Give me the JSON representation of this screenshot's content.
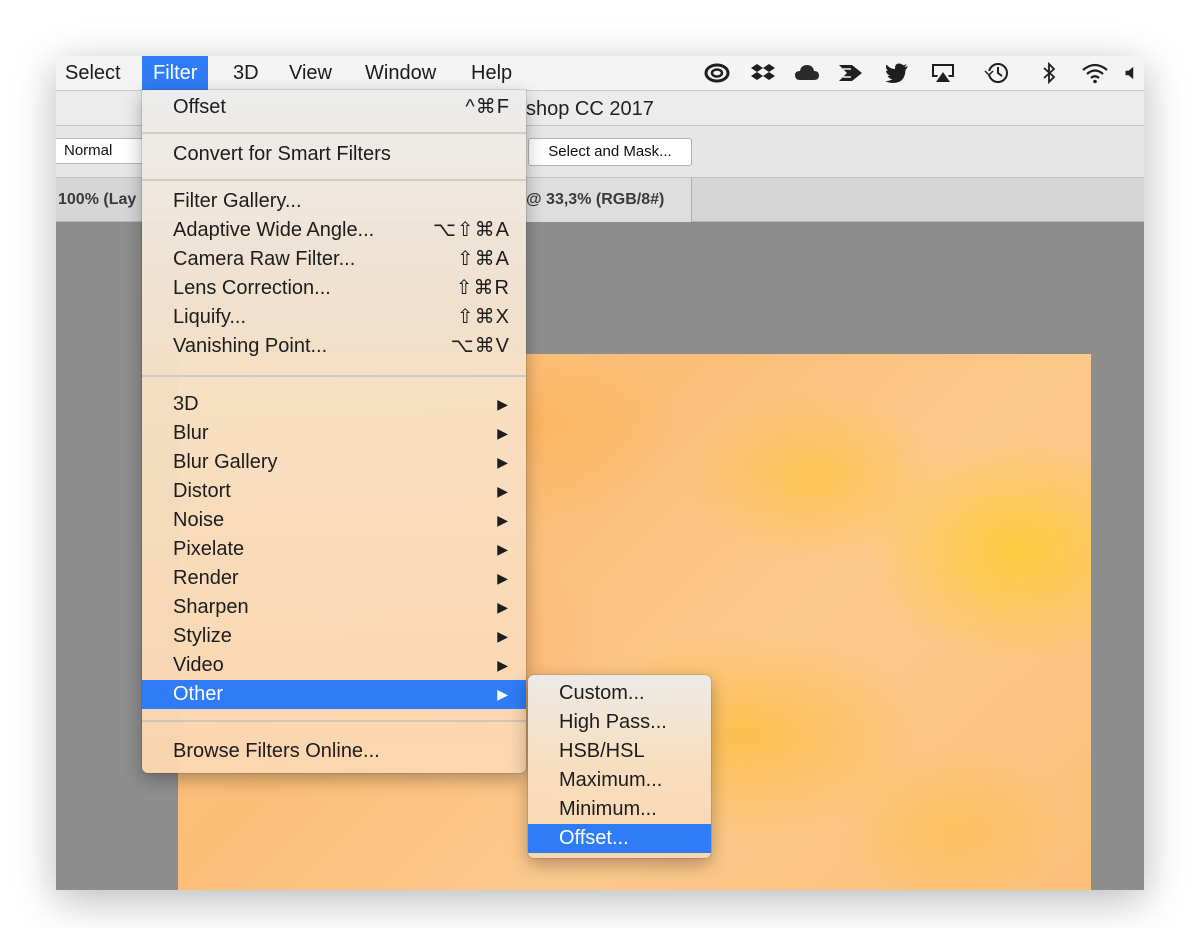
{
  "menubar": {
    "items": [
      "Select",
      "Filter",
      "3D",
      "View",
      "Window",
      "Help"
    ],
    "active": "Filter",
    "status_icons": [
      "creative-cloud-icon",
      "dropbox-icon",
      "cloud-icon",
      "airmail-icon",
      "twitter-icon",
      "airplay-icon",
      "time-machine-icon",
      "bluetooth-icon",
      "wifi-icon",
      "volume-icon"
    ]
  },
  "window": {
    "title_fragment": "shop CC 2017"
  },
  "options_bar": {
    "mode": "Normal",
    "select_mask": "Select and Mask..."
  },
  "tabs": {
    "left": "100% (Lay",
    "right": "@ 33,3% (RGB/8#)"
  },
  "filter_menu": {
    "last": {
      "label": "Offset",
      "shortcut": "^⌘F"
    },
    "smart": "Convert for Smart Filters",
    "group1": [
      {
        "label": "Filter Gallery...",
        "shortcut": ""
      },
      {
        "label": "Adaptive Wide Angle...",
        "shortcut": "⌥⇧⌘A"
      },
      {
        "label": "Camera Raw Filter...",
        "shortcut": "⇧⌘A"
      },
      {
        "label": "Lens Correction...",
        "shortcut": "⇧⌘R"
      },
      {
        "label": "Liquify...",
        "shortcut": "⇧⌘X"
      },
      {
        "label": "Vanishing Point...",
        "shortcut": "⌥⌘V"
      }
    ],
    "submenus": [
      "3D",
      "Blur",
      "Blur Gallery",
      "Distort",
      "Noise",
      "Pixelate",
      "Render",
      "Sharpen",
      "Stylize",
      "Video",
      "Other"
    ],
    "highlighted": "Other",
    "browse": "Browse Filters Online..."
  },
  "other_menu": {
    "items": [
      "Custom...",
      "High Pass...",
      "HSB/HSL",
      "Maximum...",
      "Minimum...",
      "Offset..."
    ],
    "highlighted": "Offset..."
  },
  "colors": {
    "highlight": "#2f7cf6",
    "workspace": "#8e8e8e",
    "canvas": "#fbc07a"
  }
}
